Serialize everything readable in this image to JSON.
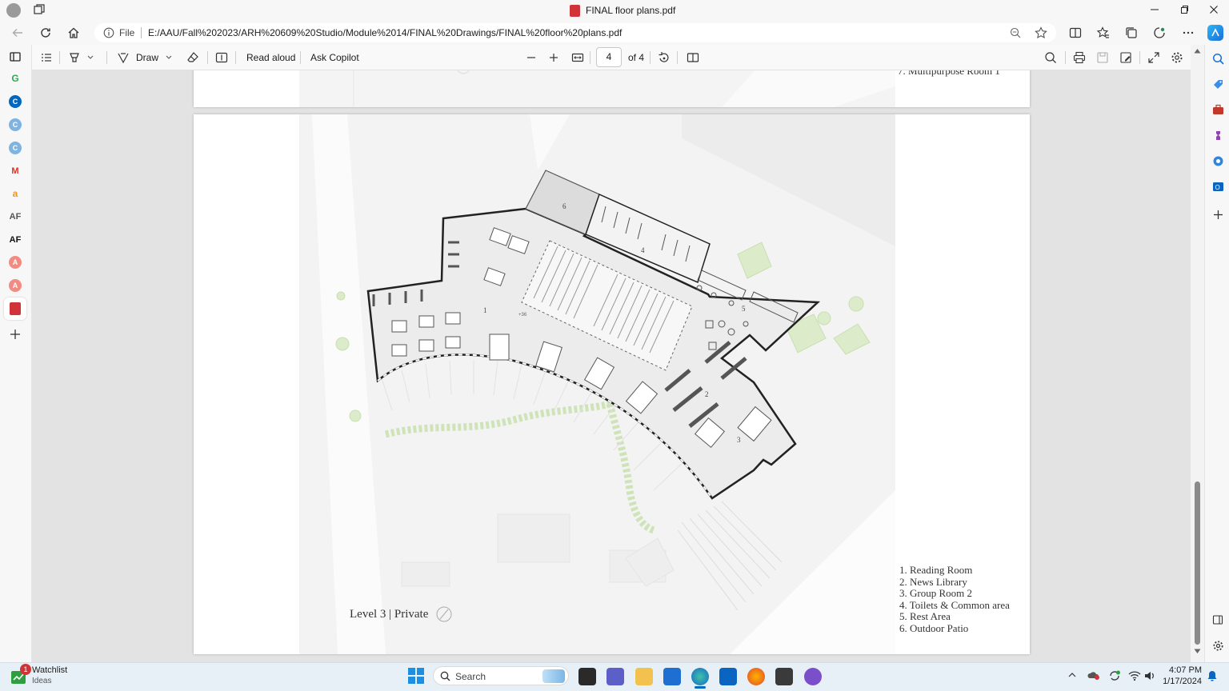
{
  "window": {
    "title": "FINAL floor plans.pdf"
  },
  "address": {
    "site_info_label": "File",
    "url": "E:/AAU/Fall%202023/ARH%20609%20Studio/Module%2014/FINAL%20Drawings/FINAL%20floor%20plans.pdf"
  },
  "toolbar": {
    "draw_label": "Draw",
    "read_aloud_label": "Read aloud",
    "ask_copilot_label": "Ask Copilot",
    "page_number": "4",
    "page_total": "of 4"
  },
  "document": {
    "prev_page_partial_text": "7. Multipurpose Room 1",
    "plan_title": "Level 3 | Private",
    "room_numbers": [
      "1",
      "2",
      "3",
      "4",
      "5",
      "6"
    ],
    "level_marker": "+36",
    "legend": [
      "1. Reading Room",
      "2. News Library",
      "3. Group Room 2",
      "4. Toilets & Common area",
      "5. Rest Area",
      "6. Outdoor Patio"
    ]
  },
  "taskbar": {
    "widget_title": "Watchlist",
    "widget_subtitle": "Ideas",
    "widget_badge": "1",
    "search_label": "Search",
    "time": "4:07 PM",
    "date": "1/17/2024"
  },
  "colors": {
    "accent": "#0067c0",
    "pdf_red": "#d13438",
    "plan_green": "#cfe3b8"
  },
  "icons": {
    "window_controls": [
      "minimize-icon",
      "maximize-icon",
      "close-icon"
    ]
  }
}
